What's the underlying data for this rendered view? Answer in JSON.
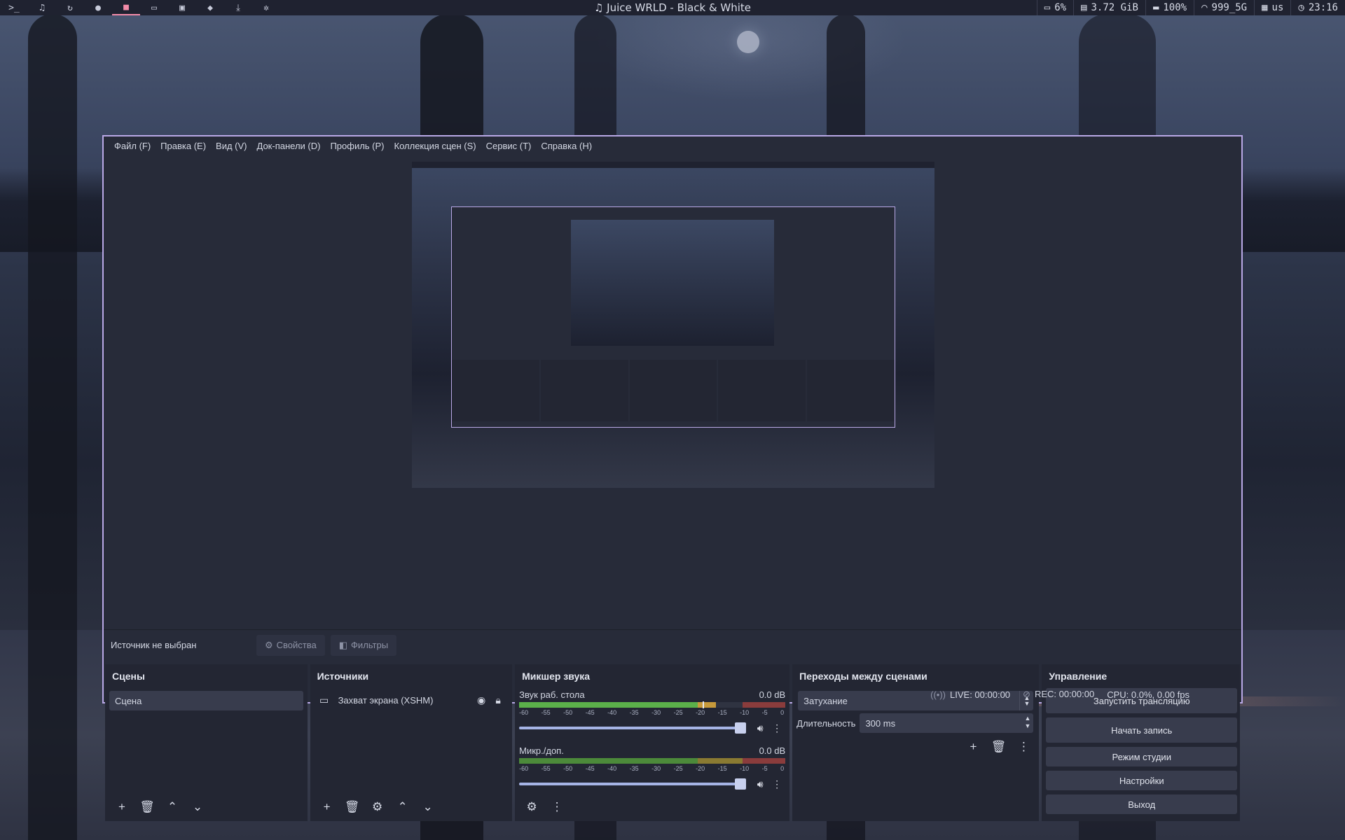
{
  "topbar": {
    "workspaces": [
      {
        "icon": "terminal-icon",
        "glyph": ">_"
      },
      {
        "icon": "music-icon",
        "glyph": "♫"
      },
      {
        "icon": "refresh-icon",
        "glyph": "↻"
      },
      {
        "icon": "chat-icon",
        "glyph": "●"
      },
      {
        "icon": "video-camera-icon",
        "glyph": "■",
        "active": true
      },
      {
        "icon": "folder-icon",
        "glyph": "▭"
      },
      {
        "icon": "image-icon",
        "glyph": "▣"
      },
      {
        "icon": "cube-icon",
        "glyph": "◆"
      },
      {
        "icon": "download-icon",
        "glyph": "⤓"
      },
      {
        "icon": "gear-icon",
        "glyph": "✲"
      }
    ],
    "now_playing": "♫ Juice WRLD - Black & White",
    "cpu": "6%",
    "memory": "3.72 GiB",
    "battery": "100%",
    "wifi": "999_5G",
    "keyboard": "us",
    "clock": "23:16"
  },
  "obs": {
    "menu": [
      "Файл (F)",
      "Правка (E)",
      "Вид (V)",
      "Док-панели (D)",
      "Профиль (P)",
      "Коллекция сцен (S)",
      "Сервис (T)",
      "Справка (H)"
    ],
    "source_bar": {
      "no_source": "Источник не выбран",
      "properties": "Свойства",
      "filters": "Фильтры"
    },
    "scenes": {
      "title": "Сцены",
      "items": [
        "Сцена"
      ]
    },
    "sources": {
      "title": "Источники",
      "items": [
        "Захват экрана (XSHM)"
      ]
    },
    "mixer": {
      "title": "Микшер звука",
      "channels": [
        {
          "name": "Звук раб. стола",
          "level": "0.0 dB",
          "volume": 1.0
        },
        {
          "name": "Микр./доп.",
          "level": "0.0 dB",
          "volume": 1.0
        }
      ],
      "ticks": [
        "-60",
        "-55",
        "-50",
        "-45",
        "-40",
        "-35",
        "-30",
        "-25",
        "-20",
        "-15",
        "-10",
        "-5",
        "0"
      ]
    },
    "transitions": {
      "title": "Переходы между сценами",
      "selected": "Затухание",
      "duration_label": "Длительность",
      "duration_value": "300 ms"
    },
    "controls": {
      "title": "Управление",
      "start_stream": "Запустить трансляцию",
      "start_record": "Начать запись",
      "studio_mode": "Режим студии",
      "settings": "Настройки",
      "exit": "Выход"
    },
    "status": {
      "live": "LIVE: 00:00:00",
      "rec": "REC: 00:00:00",
      "cpu": "CPU: 0.0%, 0.00 fps"
    }
  }
}
